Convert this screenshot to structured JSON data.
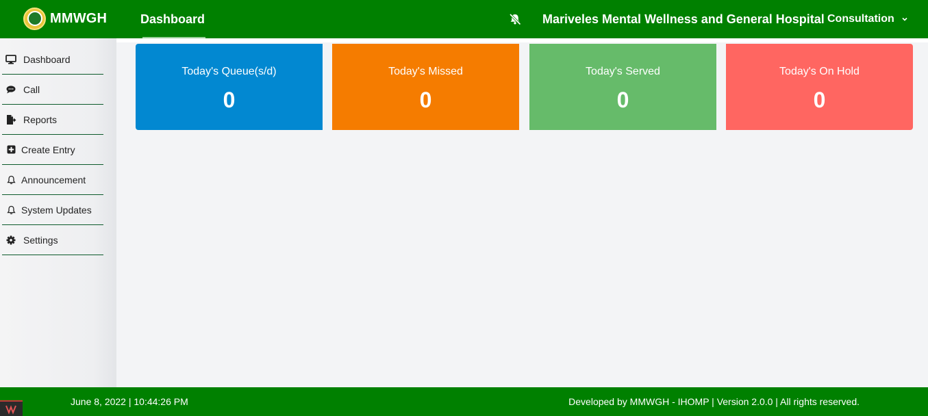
{
  "header": {
    "brand": "MMWGH",
    "nav_dashboard": "Dashboard",
    "hospital_name": "Mariveles Mental Wellness and General Hospital",
    "department": "Consultation"
  },
  "sidebar": {
    "items": [
      {
        "label": "Dashboard",
        "icon": "monitor-icon"
      },
      {
        "label": "Call",
        "icon": "speech-bubble-icon"
      },
      {
        "label": "Reports",
        "icon": "file-export-icon"
      },
      {
        "label": "Create Entry",
        "icon": "plus-square-icon"
      },
      {
        "label": "Announcement",
        "icon": "bell-icon"
      },
      {
        "label": "System Updates",
        "icon": "bell-icon"
      },
      {
        "label": "Settings",
        "icon": "gear-icon"
      }
    ]
  },
  "cards": [
    {
      "title": "Today's Queue(s/d)",
      "value": "0",
      "color": "#0288d1"
    },
    {
      "title": "Today's Missed",
      "value": "0",
      "color": "#f57c00"
    },
    {
      "title": "Today's Served",
      "value": "0",
      "color": "#66bb6a"
    },
    {
      "title": "Today's On Hold",
      "value": "0",
      "color": "#ff6661"
    }
  ],
  "footer": {
    "datetime": "June 8, 2022 | 10:44:26 PM",
    "credit": "Developed by MMWGH - IHOMP | Version 2.0.0 | All rights reserved."
  },
  "colors": {
    "brand_green": "#008000",
    "sidebar_divider": "#0b5a2a",
    "page_bg": "#f3f4f6"
  }
}
